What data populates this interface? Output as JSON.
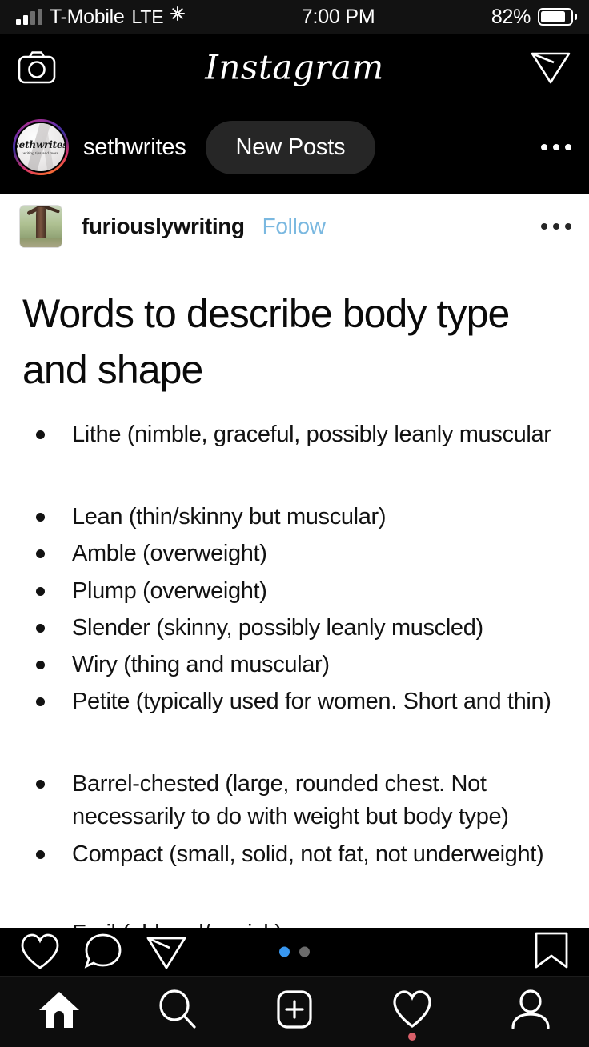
{
  "status_bar": {
    "carrier": "T-Mobile",
    "network": "LTE",
    "time": "7:00 PM",
    "battery_percent": "82%",
    "signal_icon": "signal-bars-icon",
    "activity_icon": "network-activity-icon",
    "battery_icon": "battery-icon"
  },
  "nav_header": {
    "camera_icon": "camera-icon",
    "logo_text": "Instagram",
    "direct_icon": "paper-plane-icon"
  },
  "story_row": {
    "avatar_name": "sethwrites",
    "avatar_tagline": "writing tips and more",
    "username": "sethwrites",
    "new_posts_label": "New Posts",
    "more_icon": "ellipsis-icon"
  },
  "post": {
    "avatar_icon": "tree-photo-avatar",
    "username": "furiouslywriting",
    "follow_label": "Follow",
    "more_icon": "ellipsis-icon",
    "slide": {
      "title": "Words to describe body type and shape",
      "items": [
        "Lithe (nimble, graceful, possibly leanly muscular",
        "Lean (thin/skinny but muscular)",
        "Amble (overweight)",
        "Plump (overweight)",
        "Slender (skinny, possibly leanly muscled)",
        "Wiry (thing and muscular)",
        "Petite (typically used for women. Short and thin)",
        "Barrel-chested (large, rounded chest. Not necessarily to do with weight but body type)",
        "Compact (small, solid, not fat, not underweight)",
        "Frail (old and/or sick)"
      ]
    },
    "actions": {
      "like_icon": "heart-icon",
      "comment_icon": "comment-bubble-icon",
      "share_icon": "paper-plane-icon",
      "save_icon": "bookmark-icon",
      "carousel_dots": [
        "active",
        "inactive"
      ],
      "active_dot_color": "#3897f0",
      "inactive_dot_color": "#6b6b6b"
    }
  },
  "tab_bar": {
    "items": [
      {
        "name": "home",
        "icon": "home-icon",
        "active": true
      },
      {
        "name": "search",
        "icon": "search-icon",
        "active": false
      },
      {
        "name": "create",
        "icon": "plus-square-icon",
        "active": false
      },
      {
        "name": "activity",
        "icon": "heart-icon",
        "active": false,
        "notification": true
      },
      {
        "name": "profile",
        "icon": "person-icon",
        "active": false
      }
    ],
    "notification_dot_color": "#d9606a"
  },
  "colors": {
    "background": "#000000",
    "post_background": "#ffffff",
    "follow_link": "#7ab8e0",
    "pill_background": "#262626",
    "accent_blue": "#3897f0"
  }
}
